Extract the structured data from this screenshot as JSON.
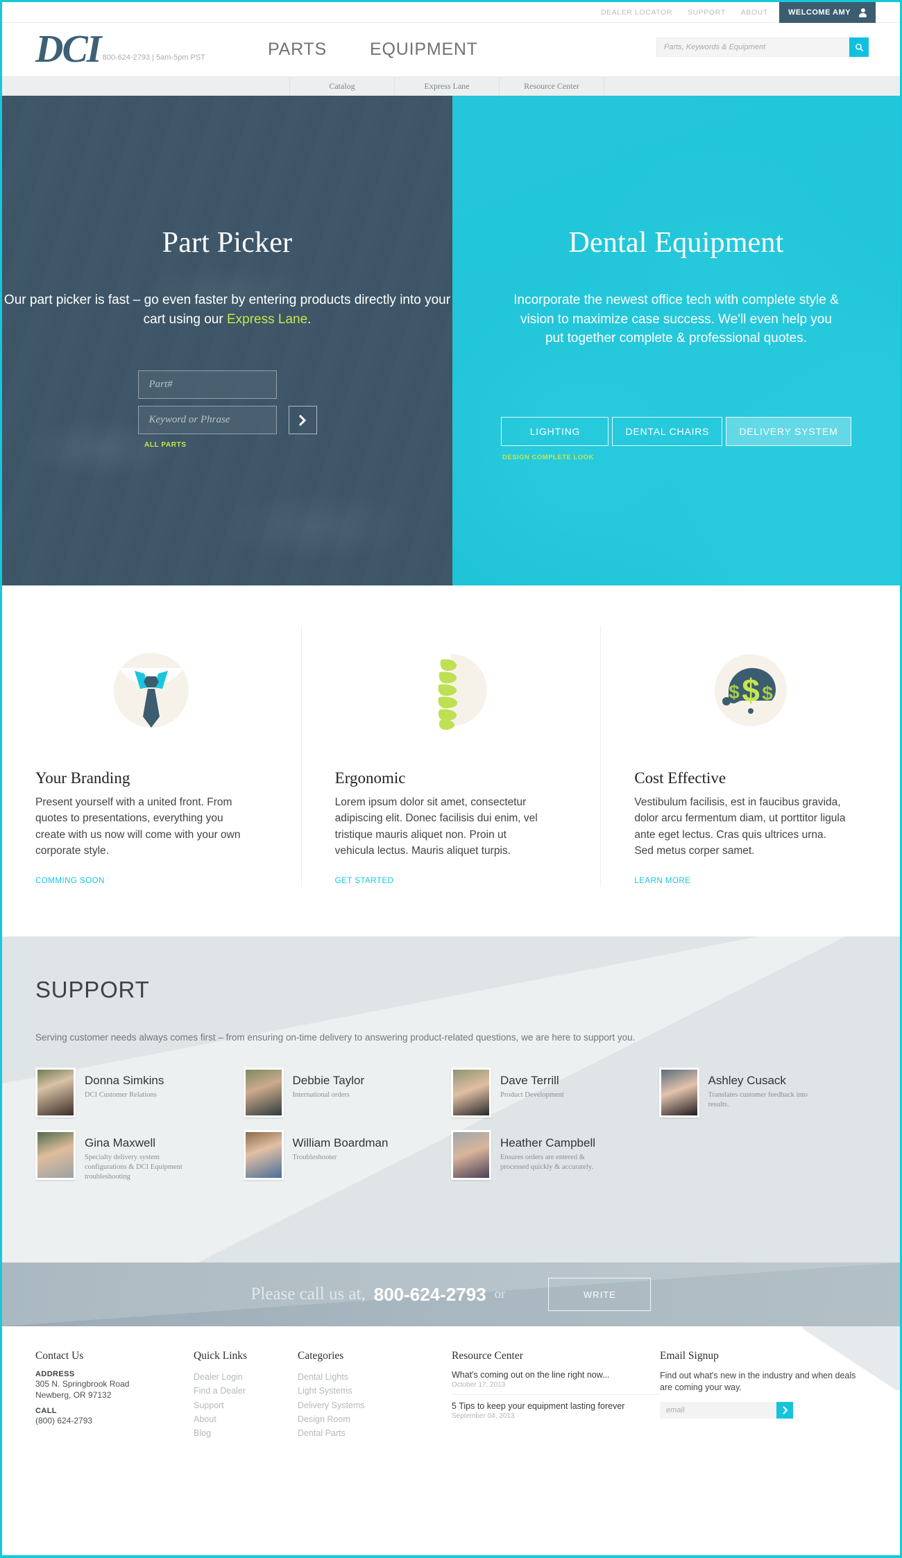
{
  "colors": {
    "brand_cyan": "#15c8da",
    "dark_slate": "#3c5c70",
    "lime": "#c6e64f",
    "support_bg": "#dfe4e6"
  },
  "utility": {
    "links": [
      "DEALER LOCATOR",
      "SUPPORT",
      "ABOUT"
    ],
    "welcome_label": "WELCOME AMY",
    "user_icon": "user-icon"
  },
  "header": {
    "logo": "DCI",
    "logo_tagline": "800-624-2793  |  5am-5pm PST",
    "nav": [
      "PARTS",
      "EQUIPMENT"
    ],
    "search_placeholder": "Parts, Keywords & Equipment",
    "search_value": "",
    "search_icon": "search-icon"
  },
  "subnav": {
    "items": [
      "Catalog",
      "Express Lane",
      "Resource Center"
    ]
  },
  "hero": {
    "left": {
      "title": "Part Picker",
      "desc_before": "Our part picker is fast – go even faster by entering products directly into your cart using our ",
      "desc_link": "Express Lane",
      "desc_after": ".",
      "part_placeholder": "Part#",
      "part_value": "",
      "keyword_placeholder": "Keyword or Phrase",
      "keyword_value": "",
      "go_icon": "chevron-right-icon",
      "all_parts_label": "ALL PARTS"
    },
    "right": {
      "title": "Dental Equipment",
      "desc": "Incorporate the newest office tech with complete style & vision to maximize case success. We'll even help you put together complete & professional quotes.",
      "buttons": [
        "LIGHTING",
        "DENTAL CHAIRS",
        "DELIVERY SYSTEM"
      ],
      "active_button": "DELIVERY SYSTEM",
      "design_link": "DESIGN COMPLETE LOOK",
      "cursor_icon": "pointer-hand-cursor"
    }
  },
  "features": [
    {
      "icon": "necktie-icon",
      "title": "Your Branding",
      "body": "Present yourself with a united front. From quotes to presentations, everything you create with us now will come with your own corporate style.",
      "link": "COMMING SOON"
    },
    {
      "icon": "spine-icon",
      "title": "Ergonomic",
      "body": "Lorem ipsum dolor sit amet, consectetur adipiscing elit. Donec facilisis dui enim, vel tristique mauris aliquet non. Proin ut vehicula lectus. Mauris aliquet turpis.",
      "link": "GET STARTED"
    },
    {
      "icon": "money-brain-icon",
      "title": "Cost Effective",
      "body": "Vestibulum facilisis, est in faucibus gravida, dolor arcu fermentum diam, ut porttitor ligula ante eget lectus. Cras quis ultrices urna. Sed metus corper samet.",
      "link": "LEARN MORE"
    }
  ],
  "support": {
    "heading": "SUPPORT",
    "intro": "Serving customer needs always comes first – from ensuring on-time delivery to answering product-related questions, we are here to support you.",
    "staff": [
      {
        "name": "Donna Simkins",
        "role": "DCI Customer Relations"
      },
      {
        "name": "Debbie Taylor",
        "role": "International orders"
      },
      {
        "name": "Dave Terrill",
        "role": "Product Development"
      },
      {
        "name": "Ashley Cusack",
        "role": "Translates customer feedback into results."
      },
      {
        "name": "Gina Maxwell",
        "role": "Specialty delivery system configurations &  DCI Equipment troubleshooting"
      },
      {
        "name": "William Boardman",
        "role": "Troubleshooter"
      },
      {
        "name": "Heather Campbell",
        "role": "Ensures orders are entered & processed quickly & accurately."
      }
    ]
  },
  "call_band": {
    "text": "Please call us at,",
    "number": "800-624-2793",
    "or": "or",
    "write_label": "WRITE"
  },
  "footer": {
    "contact": {
      "heading": "Contact Us",
      "address_label": "ADDRESS",
      "address_line1": "305 N. Springbrook Road",
      "address_line2": "Newberg, OR 97132",
      "call_label": "CALL",
      "phone": "(800) 624-2793"
    },
    "quick_links": {
      "heading": "Quick Links",
      "items": [
        "Dealer Login",
        "Find a Dealer",
        "Support",
        "About",
        "Blog"
      ]
    },
    "categories": {
      "heading": "Categories",
      "items": [
        "Dental Lights",
        "Light Systems",
        "Delivery Systems",
        "Design Room",
        "Dental Parts"
      ]
    },
    "resource_center": {
      "heading": "Resource Center",
      "items": [
        {
          "title": "What's coming out on the line right now...",
          "date": "October 17, 2013"
        },
        {
          "title": "5 Tips to keep your equipment lasting forever",
          "date": "September 04, 2013"
        }
      ]
    },
    "email_signup": {
      "heading": "Email Signup",
      "description": "Find out what's new in the industry and when deals are coming your way.",
      "placeholder": "email",
      "value": "",
      "submit_icon": "chevron-right-icon"
    }
  }
}
